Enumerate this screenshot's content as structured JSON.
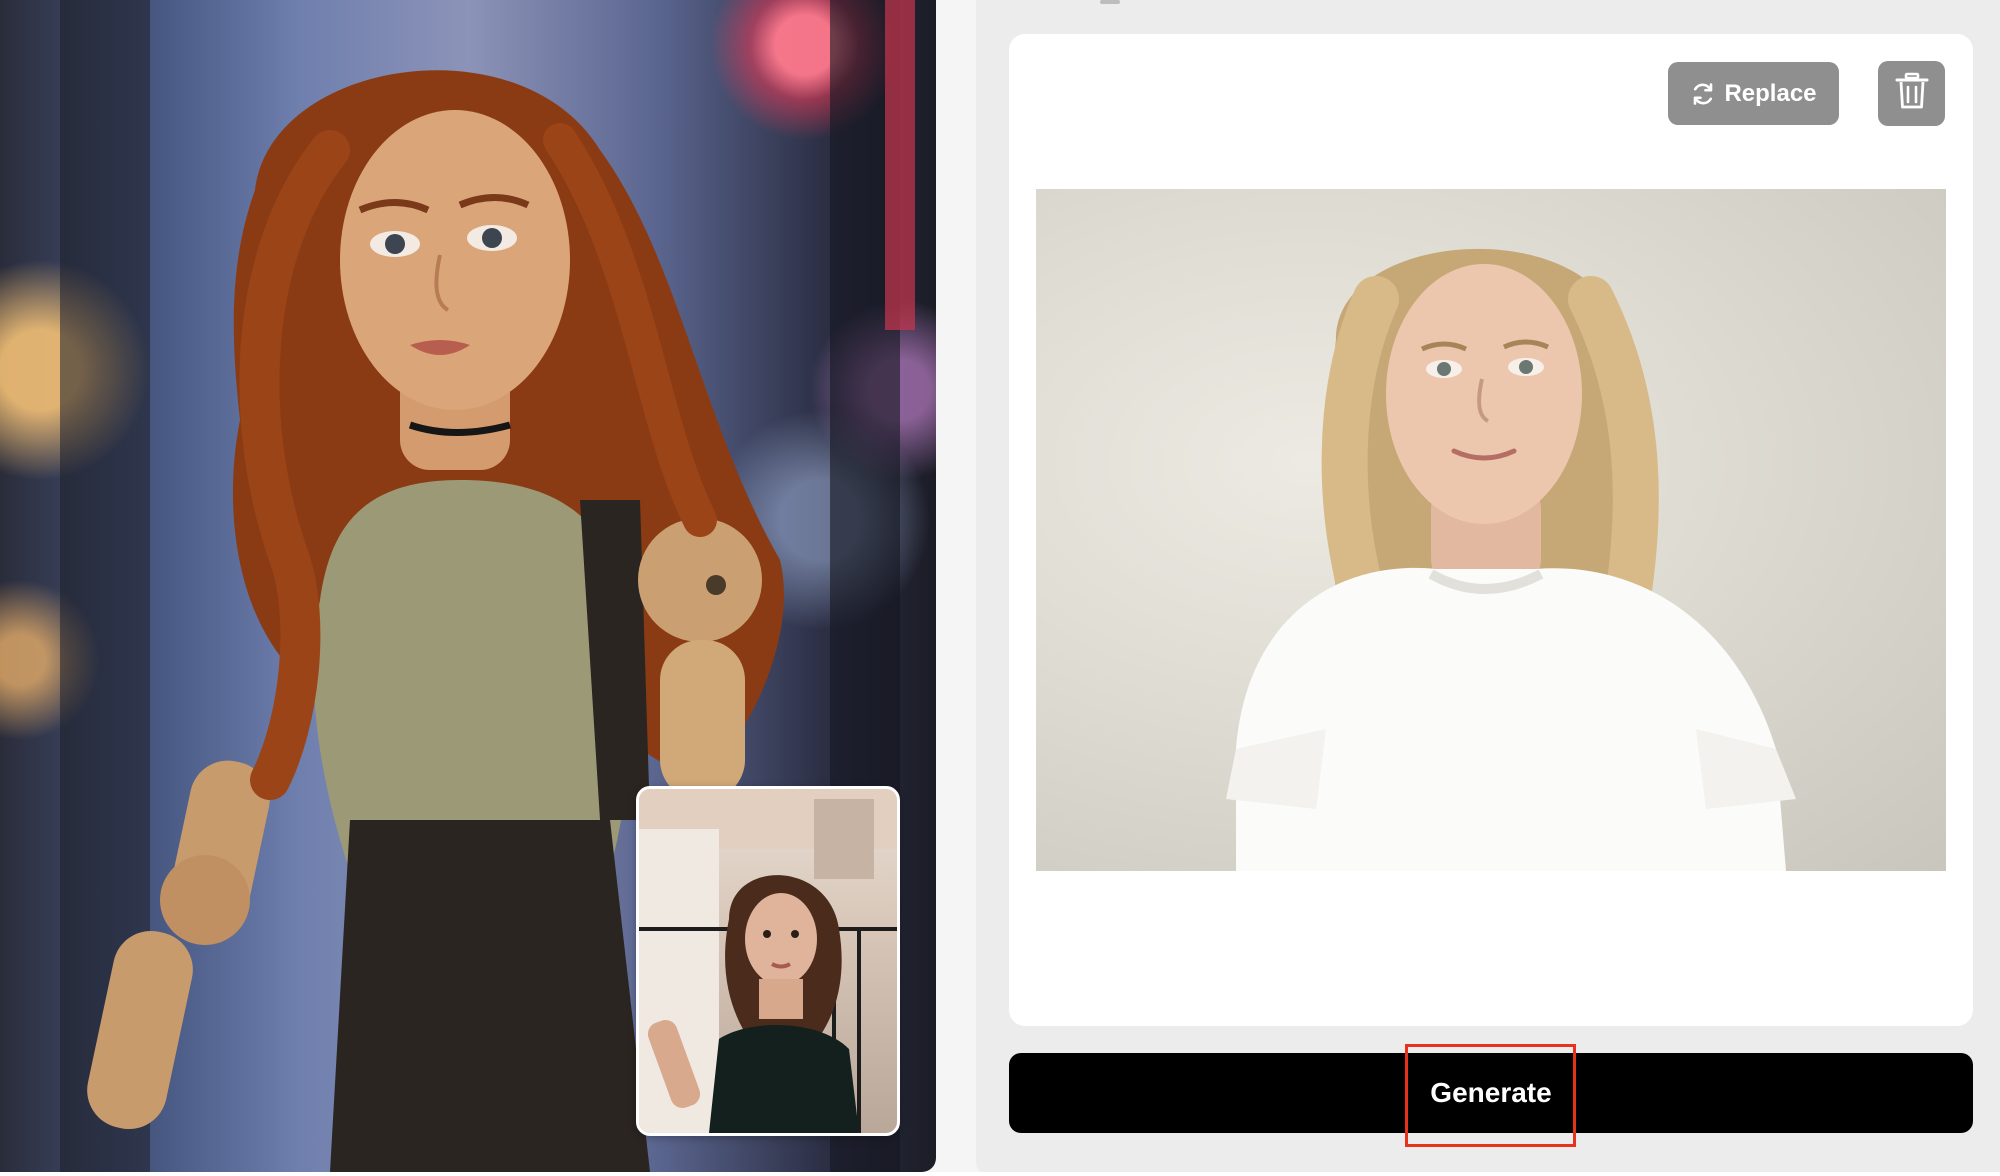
{
  "result_preview": {
    "image_description_icon": "doll-photo"
  },
  "reference_thumbnail": {
    "icon": "reference-face-photo"
  },
  "upload_card": {
    "replace_label": "Replace",
    "replace_icon": "refresh-icon",
    "delete_icon": "trash-icon",
    "photo_icon": "uploaded-face-photo"
  },
  "actions": {
    "generate_label": "Generate"
  },
  "colors": {
    "panel_bg": "#ececed",
    "card_bg": "#ffffff",
    "button_gray": "#8f8f8f",
    "generate_bg": "#000000",
    "highlight": "#e8321e"
  }
}
